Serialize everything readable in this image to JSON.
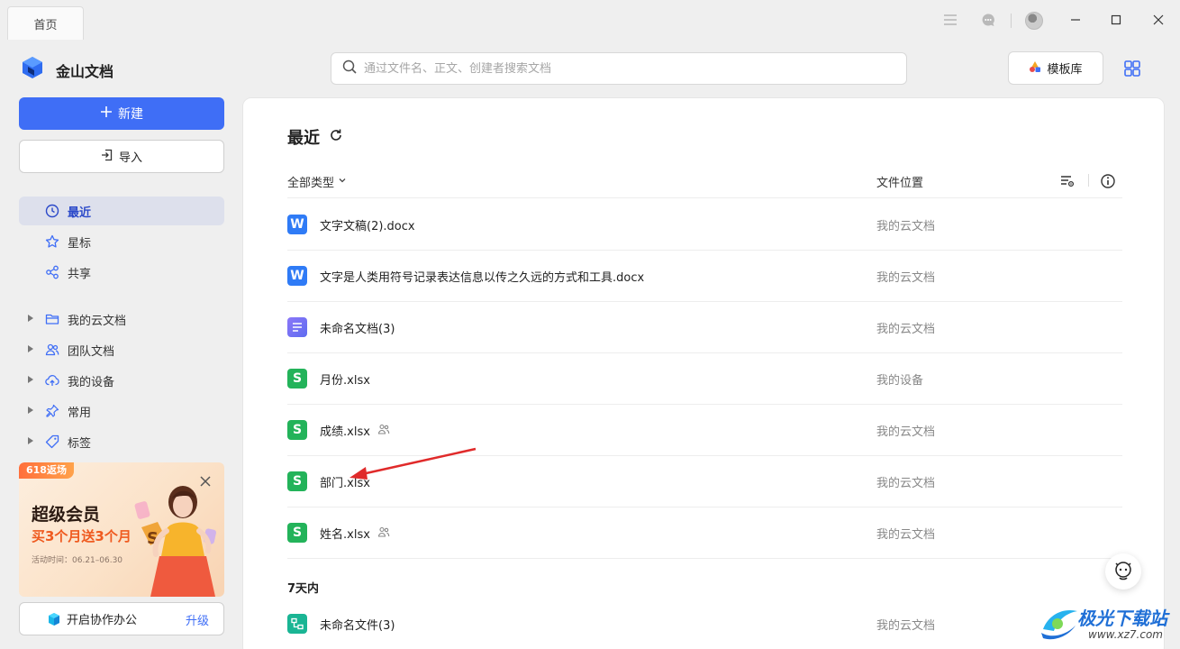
{
  "titlebar": {
    "tab_label": "首页"
  },
  "header": {
    "app_name": "金山文档",
    "search_placeholder": "通过文件名、正文、创建者搜索文档",
    "template_button": "模板库"
  },
  "sidebar": {
    "new_button": "新建",
    "import_button": "导入",
    "nav_items": [
      {
        "label": "最近",
        "icon": "clock-icon",
        "active": true
      },
      {
        "label": "星标",
        "icon": "star-icon"
      },
      {
        "label": "共享",
        "icon": "share-icon"
      }
    ],
    "tree_items": [
      {
        "label": "我的云文档",
        "icon": "folder-icon"
      },
      {
        "label": "团队文档",
        "icon": "team-icon"
      },
      {
        "label": "我的设备",
        "icon": "cloud-upload-icon"
      },
      {
        "label": "常用",
        "icon": "pin-icon"
      },
      {
        "label": "标签",
        "icon": "tag-icon"
      }
    ],
    "promo": {
      "tag": "618返场",
      "title": "超级会员",
      "subtitle": "买3个月送3个月",
      "date": "活动时间：06.21–06.30"
    },
    "collab": {
      "label": "开启协作办公",
      "upgrade": "升级"
    }
  },
  "main": {
    "section_title": "最近",
    "col_type": "全部类型",
    "col_location": "文件位置",
    "files": [
      {
        "name": "文字文稿(2).docx",
        "type": "w",
        "location": "我的云文档",
        "shared": false
      },
      {
        "name": "文字是人类用符号记录表达信息以传之久远的方式和工具.docx",
        "type": "w",
        "location": "我的云文档",
        "shared": false
      },
      {
        "name": "未命名文档(3)",
        "type": "n",
        "location": "我的云文档",
        "shared": false
      },
      {
        "name": "月份.xlsx",
        "type": "s",
        "location": "我的设备",
        "shared": false
      },
      {
        "name": "成绩.xlsx",
        "type": "s",
        "location": "我的云文档",
        "shared": true
      },
      {
        "name": "部门.xlsx",
        "type": "s",
        "location": "我的云文档",
        "shared": false
      },
      {
        "name": "姓名.xlsx",
        "type": "s",
        "location": "我的云文档",
        "shared": true
      }
    ],
    "group_7days": "7天内",
    "files_7days": [
      {
        "name": "未命名文件(3)",
        "type": "p",
        "location": "我的云文档"
      }
    ]
  },
  "watermark": {
    "text": "极光下载站",
    "url": "www.xz7.com"
  },
  "colors": {
    "accent": "#3f6ef6",
    "active_bg": "#dde0ec",
    "annotation_arrow": "#e02a2a"
  }
}
